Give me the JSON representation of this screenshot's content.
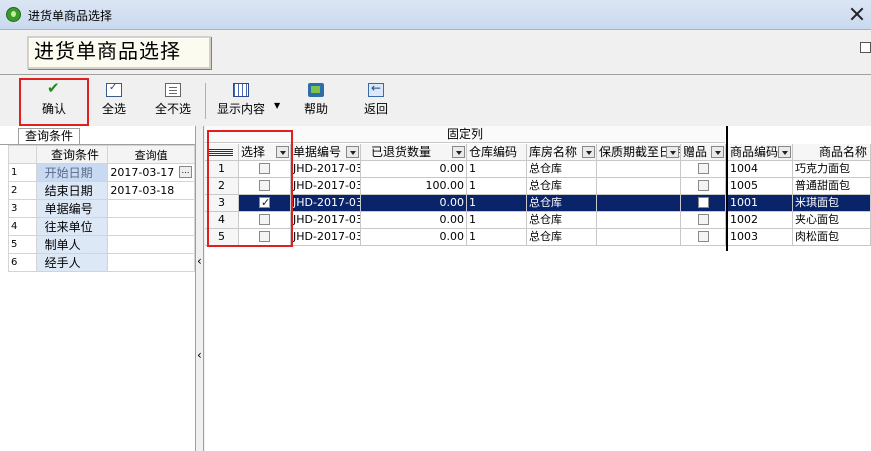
{
  "window": {
    "title": "进货单商品选择"
  },
  "caption": "进货单商品选择",
  "toolbar": {
    "confirm": "确认",
    "select_all": "全选",
    "select_none": "全不选",
    "display": "显示内容",
    "help": "帮助",
    "back": "返回"
  },
  "query": {
    "tab": "查询条件",
    "col_cond": "查询条件",
    "col_value": "查询值",
    "rows": [
      {
        "idx": "1",
        "cond": "开始日期",
        "value": "2017-03-17"
      },
      {
        "idx": "2",
        "cond": "结束日期",
        "value": "2017-03-18"
      },
      {
        "idx": "3",
        "cond": "单据编号",
        "value": ""
      },
      {
        "idx": "4",
        "cond": "往来单位",
        "value": ""
      },
      {
        "idx": "5",
        "cond": "制单人",
        "value": ""
      },
      {
        "idx": "6",
        "cond": "经手人",
        "value": ""
      }
    ]
  },
  "grid": {
    "fixed_label": "固定列",
    "headers": {
      "select": "选择",
      "doc_no": "单据编号",
      "returned_qty": "已退货数量",
      "warehouse_code": "仓库编码",
      "warehouse_name": "库房名称",
      "expiry": "保质期截至日期",
      "gift": "赠品",
      "product_code": "商品编码",
      "product_name": "商品名称"
    },
    "rows": [
      {
        "idx": "1",
        "checked": false,
        "doc_no": "JHD-2017-03",
        "qty": "0.00",
        "wh_code": "1",
        "wh_name": "总仓库",
        "expiry": "",
        "product_code": "1004",
        "product_name": "巧克力面包"
      },
      {
        "idx": "2",
        "checked": false,
        "doc_no": "JHD-2017-03",
        "qty": "100.00",
        "wh_code": "1",
        "wh_name": "总仓库",
        "expiry": "",
        "product_code": "1005",
        "product_name": "普通甜面包"
      },
      {
        "idx": "3",
        "checked": true,
        "doc_no": "JHD-2017-03",
        "qty": "0.00",
        "wh_code": "1",
        "wh_name": "总仓库",
        "expiry": "",
        "product_code": "1001",
        "product_name": "米琪面包"
      },
      {
        "idx": "4",
        "checked": false,
        "doc_no": "JHD-2017-03",
        "qty": "0.00",
        "wh_code": "1",
        "wh_name": "总仓库",
        "expiry": "",
        "product_code": "1002",
        "product_name": "夹心面包"
      },
      {
        "idx": "5",
        "checked": false,
        "doc_no": "JHD-2017-03",
        "qty": "0.00",
        "wh_code": "1",
        "wh_name": "总仓库",
        "expiry": "",
        "product_code": "1003",
        "product_name": "肉松面包"
      }
    ]
  },
  "colors": {
    "selected_row": "#0a246a",
    "highlight": "#e02020"
  }
}
